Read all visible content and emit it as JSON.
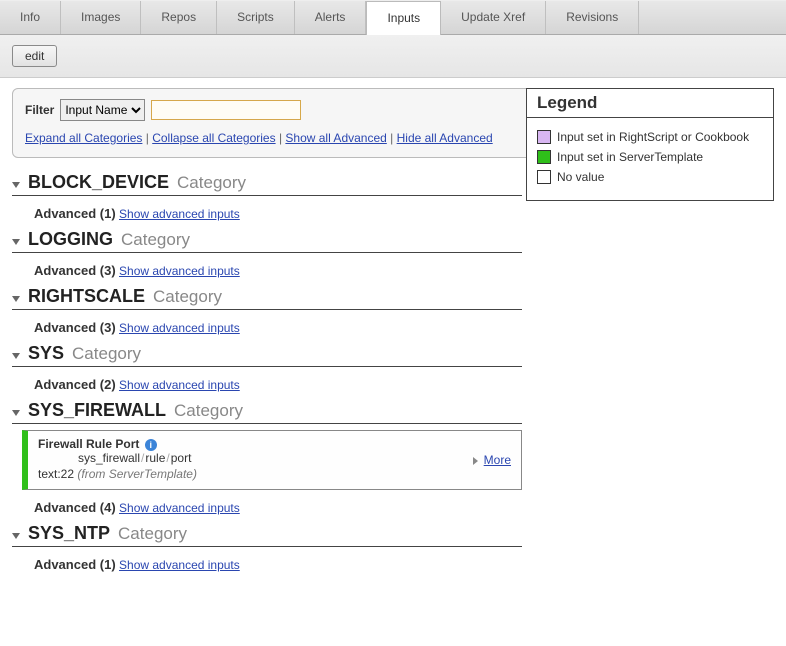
{
  "tabs": [
    {
      "label": "Info"
    },
    {
      "label": "Images"
    },
    {
      "label": "Repos"
    },
    {
      "label": "Scripts"
    },
    {
      "label": "Alerts"
    },
    {
      "label": "Inputs"
    },
    {
      "label": "Update Xref"
    },
    {
      "label": "Revisions"
    }
  ],
  "toolbar": {
    "edit": "edit"
  },
  "filter": {
    "label": "Filter",
    "select_value": "Input Name",
    "input_value": ""
  },
  "links": {
    "expand": "Expand all Categories",
    "collapse": "Collapse all Categories",
    "show_adv": "Show all Advanced",
    "hide_adv": "Hide all Advanced"
  },
  "legend": {
    "title": "Legend",
    "items": [
      {
        "color": "#d8b6f2",
        "label": "Input set in RightScript or Cookbook"
      },
      {
        "color": "#2fbf1a",
        "label": "Input set in ServerTemplate"
      },
      {
        "color": "#ffffff",
        "label": "No value"
      }
    ]
  },
  "category_suffix": "Category",
  "advanced_label_prefix": "Advanced",
  "advanced_link_text": "Show advanced inputs",
  "more_label": "More",
  "categories": [
    {
      "name": "BLOCK_DEVICE",
      "adv_count": 1
    },
    {
      "name": "LOGGING",
      "adv_count": 3
    },
    {
      "name": "RIGHTSCALE",
      "adv_count": 3
    },
    {
      "name": "SYS",
      "adv_count": 2
    },
    {
      "name": "SYS_FIREWALL",
      "adv_count": 4,
      "has_card": true
    },
    {
      "name": "SYS_NTP",
      "adv_count": 1
    }
  ],
  "card": {
    "title": "Firewall Rule Port",
    "path_a": "sys_firewall",
    "path_b": "rule",
    "path_c": "port",
    "value_prefix": "text:22",
    "value_note": "(from ServerTemplate)"
  }
}
